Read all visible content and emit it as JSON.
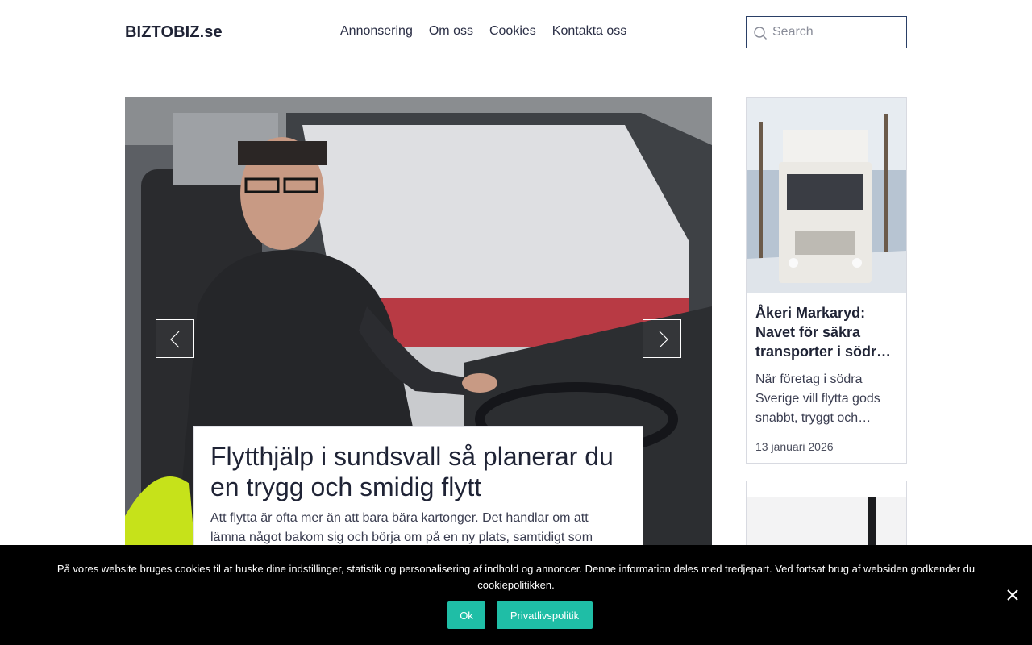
{
  "header": {
    "logo": "BIZTOBIZ.se",
    "nav": [
      "Annonsering",
      "Om oss",
      "Cookies",
      "Kontakta oss"
    ],
    "search_placeholder": "Search"
  },
  "hero": {
    "title": "Flytthjälp i sundsvall så planerar du en trygg och smidig flytt",
    "excerpt": "Att flytta är ofta mer än att bara bära kartonger. Det handlar om att lämna något bakom sig och börja om på en ny plats, samtidigt som vardagen"
  },
  "cards": [
    {
      "title": "Åkeri Markaryd: Navet för säkra transporter i södr…",
      "excerpt": "När företag i södra Sverige vill flytta gods snabbt, tryggt och…",
      "date": "13 januari 2026"
    }
  ],
  "cookie_bar": {
    "message": "På vores website bruges cookies til at huske dine indstillinger, statistik og personalisering af indhold og annoncer. Denne information deles med tredjepart. Ved fortsat brug af websiden godkender du cookiepolitikken.",
    "ok_label": "Ok",
    "policy_label": "Privatlivspolitik"
  },
  "colors": {
    "text": "#1f2335",
    "accent": "#1fbea6",
    "cookie_bg": "#000000",
    "search_border": "#2a3f66"
  }
}
